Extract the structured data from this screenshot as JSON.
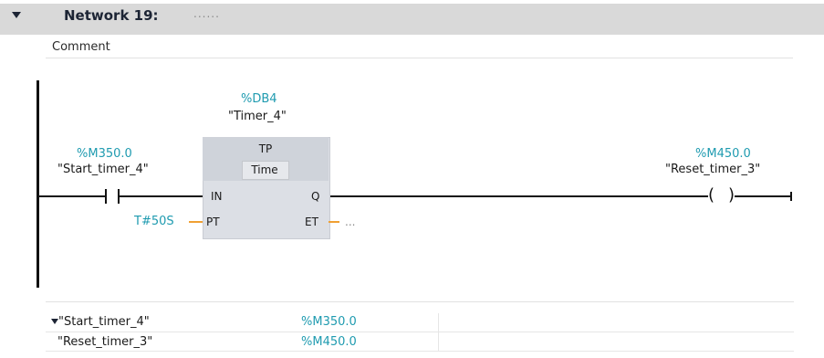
{
  "network": {
    "title": "Network 19:",
    "title_value": "......",
    "comment": "Comment"
  },
  "block": {
    "instance_address": "%DB4",
    "instance_name": "\"Timer_4\"",
    "type": "TP",
    "time_label": "Time",
    "pins": {
      "in": "IN",
      "q": "Q",
      "pt": "PT",
      "et": "ET"
    },
    "pt_value": "T#50S",
    "et_value": "..."
  },
  "contact": {
    "address": "%M350.0",
    "name": "\"Start_timer_4\""
  },
  "coil": {
    "address": "%M450.0",
    "name": "\"Reset_timer_3\"",
    "left_symbol": "(",
    "right_symbol": ")"
  },
  "tag_table": {
    "rows": [
      {
        "name": "\"Start_timer_4\"",
        "address": "%M350.0"
      },
      {
        "name": "\"Reset_timer_3\"",
        "address": "%M450.0"
      }
    ]
  },
  "colors": {
    "header_bg": "#d9d9d9",
    "address_teal": "#1f9bb0",
    "param_wire_orange": "#f0a033",
    "block_fill": "#dcdfe5"
  }
}
